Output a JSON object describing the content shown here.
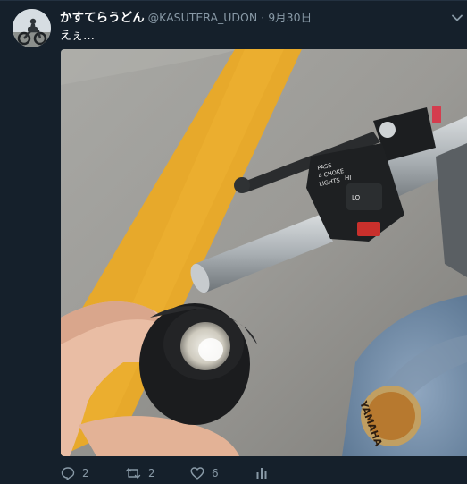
{
  "tweet": {
    "display_name": "かすてらうどん",
    "handle": "@KASUTERA_UDON",
    "separator": "·",
    "date": "9月30日",
    "text": "えぇ…"
  },
  "actions": {
    "reply_count": "2",
    "retweet_count": "2",
    "like_count": "6"
  },
  "photo_text": {
    "lights_label": "PASS\n4 CHOKE\nLIGHTS",
    "hi_label": "HI",
    "lo_label": "LO",
    "brand": "YAMAHA"
  },
  "icons": {
    "avatar": "avatar",
    "caret": "chevron-down-icon",
    "reply": "reply-icon",
    "retweet": "retweet-icon",
    "like": "heart-icon",
    "analytics": "analytics-icon"
  },
  "colors": {
    "background": "#15202b",
    "text_primary": "#ffffff",
    "text_secondary": "#8899a6",
    "divider": "#233140"
  }
}
